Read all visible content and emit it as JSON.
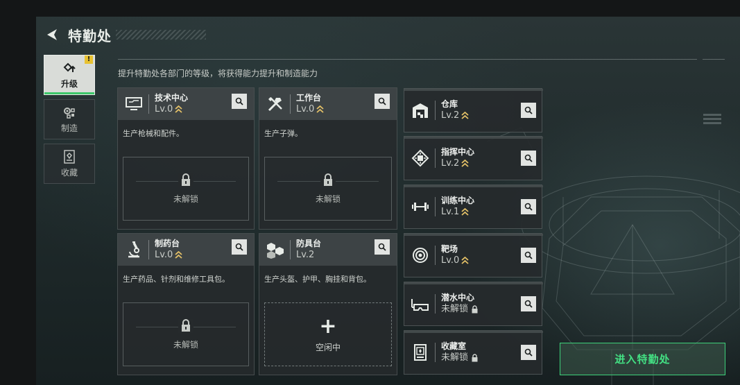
{
  "header": {
    "title": "特勤处"
  },
  "sidebar": {
    "tabs": [
      {
        "label": "升级",
        "icon": "upgrade-icon",
        "active": true,
        "badge": "!"
      },
      {
        "label": "制造",
        "icon": "gears-icon",
        "active": false
      },
      {
        "label": "收藏",
        "icon": "collection-icon",
        "active": false
      }
    ]
  },
  "subtitle": "提升特勤处各部门的等级，将获得能力提升和制造能力",
  "workshops": [
    {
      "name": "技术中心",
      "level": "Lv.0",
      "desc": "生产枪械和配件。",
      "status": "未解锁",
      "icon": "monitor-icon"
    },
    {
      "name": "工作台",
      "level": "Lv.0",
      "desc": "生产子弹。",
      "status": "未解锁",
      "icon": "tools-icon"
    },
    {
      "name": "制药台",
      "level": "Lv.0",
      "desc": "生产药品、针剂和维修工具包。",
      "status": "未解锁",
      "icon": "microscope-icon"
    },
    {
      "name": "防具台",
      "level": "Lv.2",
      "desc": "生产头盔、护甲、胸挂和背包。",
      "status": "空闲中",
      "icon": "armor-icon"
    }
  ],
  "facilities": [
    {
      "name": "仓库",
      "level": "Lv.2",
      "icon": "warehouse-icon",
      "locked": false
    },
    {
      "name": "指挥中心",
      "level": "Lv.2",
      "icon": "chip-icon",
      "locked": false
    },
    {
      "name": "训练中心",
      "level": "Lv.1",
      "icon": "dumbbell-icon",
      "locked": false
    },
    {
      "name": "靶场",
      "level": "Lv.0",
      "icon": "target-icon",
      "locked": false
    },
    {
      "name": "潜水中心",
      "level": "未解锁",
      "icon": "diving-mask-icon",
      "locked": true
    },
    {
      "name": "收藏室",
      "level": "未解锁",
      "icon": "display-case-icon",
      "locked": true
    }
  ],
  "enter_button": "进入特勤处",
  "colors": {
    "accent_green": "#43e083",
    "badge_yellow": "#e8c231",
    "upgrade_gold": "#e3c067"
  }
}
